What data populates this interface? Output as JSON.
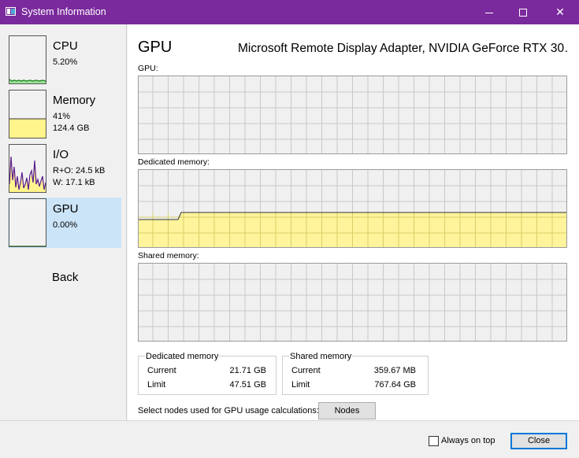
{
  "window": {
    "title": "System Information"
  },
  "sidebar": {
    "items": [
      {
        "name": "CPU",
        "value1": "5.20%",
        "value2": ""
      },
      {
        "name": "Memory",
        "value1": "41%",
        "value2": "124.4 GB"
      },
      {
        "name": "I/O",
        "value1": "R+O: 24.5 kB",
        "value2": "W: 17.1 kB"
      },
      {
        "name": "GPU",
        "value1": "0.00%",
        "value2": ""
      }
    ],
    "back_label": "Back",
    "selected": "GPU"
  },
  "main": {
    "title": "GPU",
    "adapter_name": "Microsoft Remote Display Adapter, NVIDIA GeForce RTX 30…",
    "graphs": [
      {
        "label": "GPU:",
        "fill_level": 0.0
      },
      {
        "label": "Dedicated memory:",
        "fill_level": 0.46
      },
      {
        "label": "Shared memory:",
        "fill_level": 0.0
      }
    ],
    "dedicated_memory": {
      "title": "Dedicated memory",
      "current_label": "Current",
      "current_value": "21.71 GB",
      "limit_label": "Limit",
      "limit_value": "47.51 GB"
    },
    "shared_memory": {
      "title": "Shared memory",
      "current_label": "Current",
      "current_value": "359.67 MB",
      "limit_label": "Limit",
      "limit_value": "767.64 GB"
    },
    "nodes_label": "Select nodes used for GPU usage calculations:",
    "nodes_button": "Nodes"
  },
  "footer": {
    "always_on_top_label": "Always on top",
    "always_on_top_checked": false,
    "close_label": "Close"
  },
  "colors": {
    "titlebar": "#7a2a9c",
    "selected_item": "#cce4f7",
    "memory_fill": "#fff58c",
    "cpu_line": "#2e8b2e",
    "io_line": "#5a1a8a"
  }
}
